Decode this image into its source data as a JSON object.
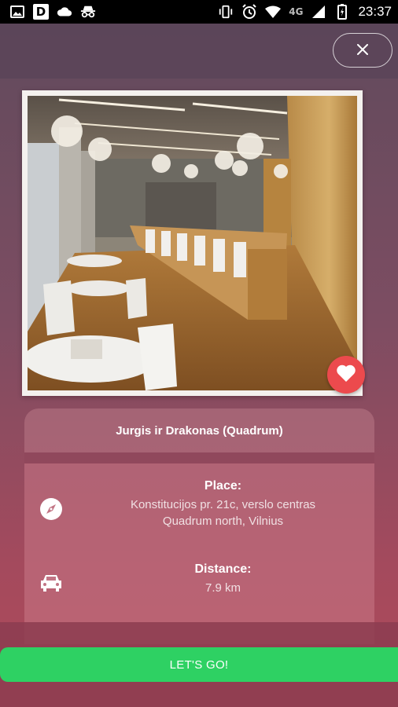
{
  "status_bar": {
    "network": "4G",
    "time": "23:37",
    "d_badge": "D",
    "icons": [
      "image-icon",
      "d-icon",
      "cloud-icon",
      "incognito-icon",
      "vibrate-icon",
      "alarm-icon",
      "wifi-icon",
      "signal-icon",
      "battery-icon"
    ]
  },
  "header": {
    "close_icon": "close-icon"
  },
  "venue": {
    "name": "Jurgis ir Drakonas (Quadrum)",
    "photo_icon": "restaurant-photo",
    "favorite_icon": "heart-icon",
    "place_label": "Place:",
    "place_value_line1": "Konstitucijos pr. 21c, verslo centras",
    "place_value_line2": "Quadrum north, Vilnius",
    "distance_label": "Distance:",
    "distance_value": "7.9 km"
  },
  "actions": {
    "go_label": "LET'S GO!"
  },
  "colors": {
    "accent_green": "#2ed163",
    "favorite_red": "#ec4a4d"
  }
}
